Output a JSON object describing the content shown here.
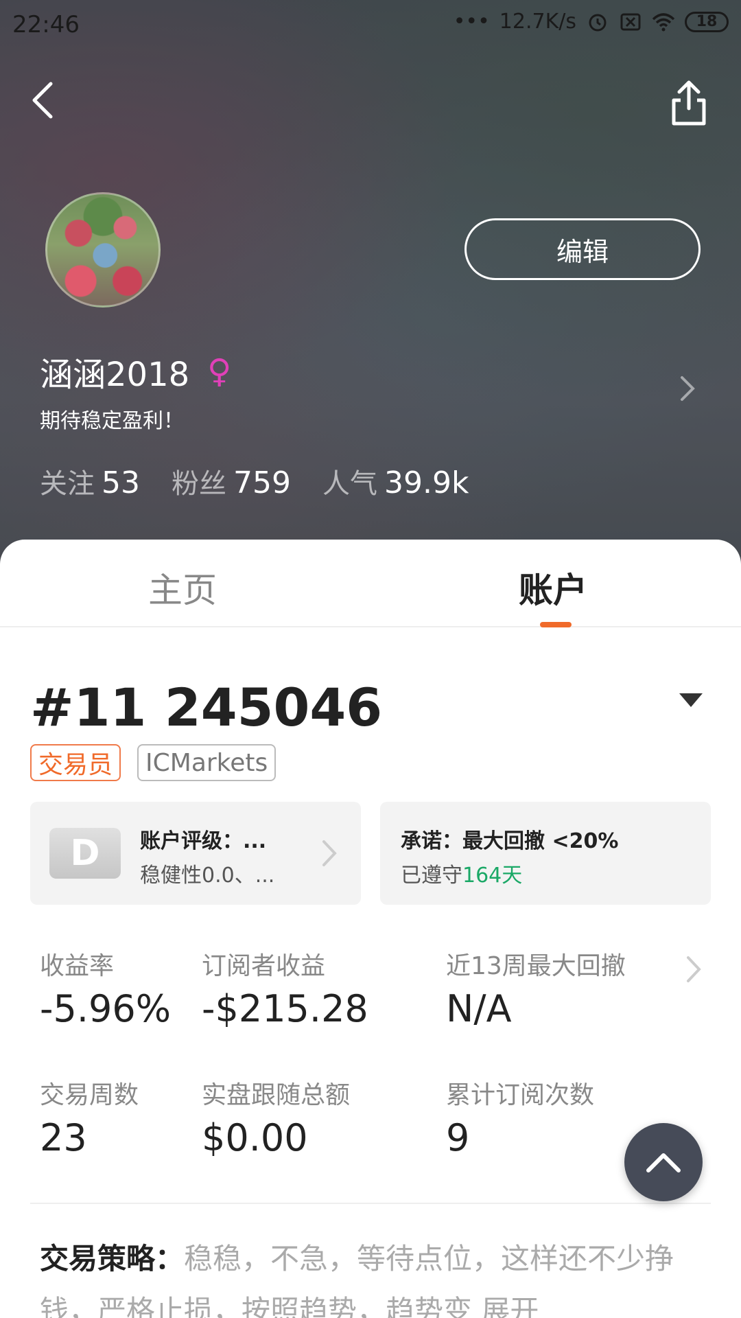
{
  "status_bar": {
    "time": "22:46",
    "network_speed": "12.7K/s",
    "battery": "18"
  },
  "profile": {
    "edit_label": "编辑",
    "username": "涵涵2018",
    "gender_symbol": "♀",
    "bio": "期待稳定盈利！",
    "stats": [
      {
        "label": "关注",
        "value": "53"
      },
      {
        "label": "粉丝",
        "value": "759"
      },
      {
        "label": "人气",
        "value": "39.9k"
      }
    ]
  },
  "tabs": [
    {
      "label": "主页",
      "active": false
    },
    {
      "label": "账户",
      "active": true
    }
  ],
  "account": {
    "number": "#11 245046",
    "tags": [
      "交易员",
      "ICMarkets"
    ],
    "rating": {
      "grade": "D",
      "title": "账户评级：...",
      "subtitle": "稳健性0.0、..."
    },
    "promise": {
      "title": "承诺：最大回撤 <20%",
      "prefix": "已遵守",
      "days": "164天"
    },
    "metrics": [
      {
        "label": "收益率",
        "value": "-5.96%"
      },
      {
        "label": "订阅者收益",
        "value": "-$215.28"
      },
      {
        "label": "近13周最大回撤",
        "value": "N/A"
      },
      {
        "label": "交易周数",
        "value": "23"
      },
      {
        "label": "实盘跟随总额",
        "value": "$0.00"
      },
      {
        "label": "累计订阅次数",
        "value": "9"
      }
    ],
    "strategy": {
      "label": "交易策略：",
      "text": "稳稳，不急，等待点位，这样还不少挣钱，严格止损，按照趋势，趋势变",
      "expand": "展开"
    }
  },
  "colors": {
    "accent": "#f06a2a",
    "positive_green": "#1aa866",
    "gender_pink": "#e040b8",
    "fab_bg": "#464b58"
  }
}
